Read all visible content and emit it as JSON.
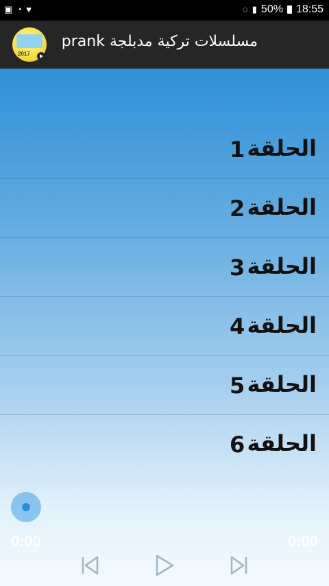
{
  "status_bar": {
    "battery": "50%",
    "time": "18:55",
    "icons": [
      "gallery-icon",
      "wifi-status-icon",
      "shield-icon",
      "mute-icon",
      "signal-icon",
      "battery-icon"
    ]
  },
  "app_bar": {
    "title": "مسلسلات تركية مدبلجة prank",
    "logo_year": "2017"
  },
  "episodes": [
    {
      "label": "الحلقة",
      "number": "1"
    },
    {
      "label": "الحلقة",
      "number": "2"
    },
    {
      "label": "الحلقة",
      "number": "3"
    },
    {
      "label": "الحلقة",
      "number": "4"
    },
    {
      "label": "الحلقة",
      "number": "5"
    },
    {
      "label": "الحلقة",
      "number": "6"
    }
  ],
  "player": {
    "elapsed": "0:00",
    "duration": "0:00",
    "progress_fraction": 0
  },
  "colors": {
    "gradient_top": "#2f8fd7",
    "gradient_bottom": "#f4fbff",
    "app_bar": "#262626",
    "status_bar": "#000000"
  }
}
